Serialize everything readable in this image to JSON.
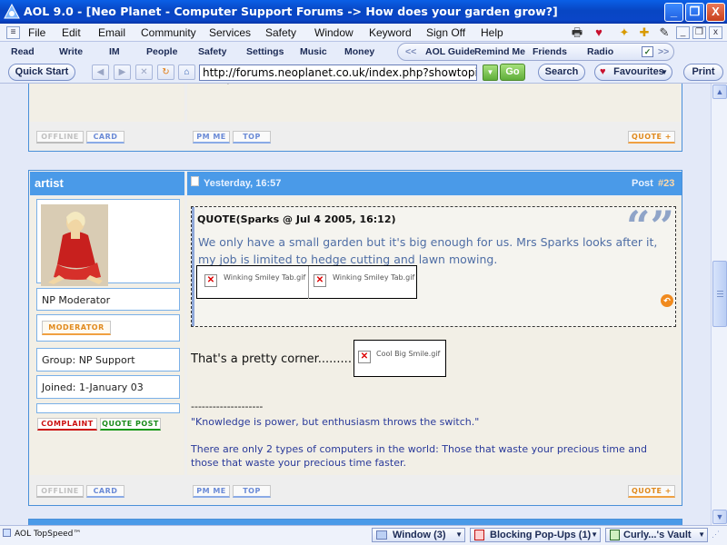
{
  "window": {
    "title": "AOL 9.0 - [Neo Planet - Computer Support Forums -> How does your garden grow?]",
    "min_glyph": "_",
    "max_glyph": "❐",
    "close_glyph": "X"
  },
  "menu": {
    "items": [
      "File",
      "Edit",
      "Email",
      "Community",
      "Services",
      "Safety",
      "Window",
      "Keyword",
      "Sign Off",
      "Help"
    ]
  },
  "aol_toolbar": {
    "items": [
      "Read",
      "Write",
      "IM",
      "People",
      "Safety",
      "Settings",
      "Music",
      "Money"
    ],
    "pill_items": [
      "AOL Guide",
      "Remind Me",
      "Friends",
      "Radio"
    ],
    "pill_left": "<<",
    "pill_right": ">>"
  },
  "nav": {
    "quick_start": "Quick Start",
    "url": "http://forums.neoplanet.co.uk/index.php?showtopic=",
    "go": "Go",
    "search": "Search",
    "favourites": "Favourites",
    "print": "Print"
  },
  "post_prev": {
    "offline": "OFFLINE",
    "card": "CARD",
    "pm": "PM ME",
    "top": "TOP",
    "quote": "QUOTE +"
  },
  "post": {
    "author": "artist",
    "date": "Yesterday, 16:57",
    "post_label": "Post",
    "post_number": "#23",
    "role": "NP Moderator",
    "badge": "MODERATOR",
    "group": "Group: NP Support",
    "joined": "Joined: 1-January 03",
    "complaint": "COMPLAINT",
    "quote_post": "QUOTE POST",
    "quote_header": "QUOTE(Sparks @ Jul 4 2005, 16:12)",
    "quote_body_1": "We only have a small garden but it's big enough for us. Mrs Sparks looks after it,",
    "quote_body_2": "my job is limited to hedge cutting and lawn mowing.",
    "quote_img_1": "Winking Smiley Tab.gif",
    "quote_img_2": "Winking Smiley Tab.gif",
    "reply_text": "That's a pretty corner.........",
    "reply_img": "Cool Big Smile.gif",
    "sig_rule": "--------------------",
    "sig_1": "\"Knowledge is power, but enthusiasm throws the switch.\"",
    "sig_2a": "There are only 2 types of computers in the world: Those that waste your precious time and",
    "sig_2b": "those that waste your precious time faster.",
    "offline": "OFFLINE",
    "card": "CARD",
    "pm": "PM ME",
    "top": "TOP",
    "quote": "QUOTE +"
  },
  "status": {
    "left": "AOL TopSpeed™",
    "window": "Window (3)",
    "popups": "Blocking Pop-Ups (1)",
    "vault": "Curly...'s Vault"
  },
  "colors": {
    "header_blue": "#4a9ae8",
    "quote_text": "#4f6ea5",
    "sig_text": "#2a3a9a",
    "titlebar": "#0846c3"
  },
  "icons": [
    "aol-triangle-icon",
    "printer-icon",
    "heart-icon",
    "sparkle-icon",
    "arrow-back-icon",
    "arrow-forward-icon",
    "stop-icon",
    "refresh-icon",
    "home-icon",
    "quote-marks-icon",
    "back-to-quote-icon",
    "broken-image-icon"
  ]
}
